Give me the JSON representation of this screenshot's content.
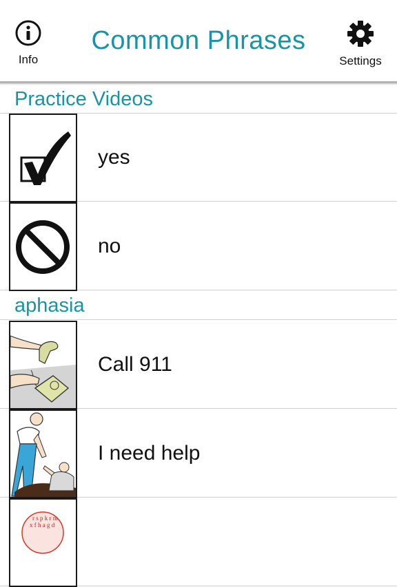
{
  "header": {
    "title": "Common Phrases",
    "info_label": "Info",
    "settings_label": "Settings",
    "accent_color": "#1694a8"
  },
  "sections": [
    {
      "title": "Practice Videos",
      "items": [
        {
          "label": "yes",
          "icon": "checkbox-checked-icon"
        },
        {
          "label": "no",
          "icon": "prohibited-icon"
        }
      ]
    },
    {
      "title": "aphasia",
      "items": [
        {
          "label": "Call 911",
          "icon": "telephone-call-picture"
        },
        {
          "label": "I need help",
          "icon": "person-helping-picture"
        },
        {
          "label": "",
          "icon": "speech-letters-picture"
        }
      ]
    }
  ]
}
